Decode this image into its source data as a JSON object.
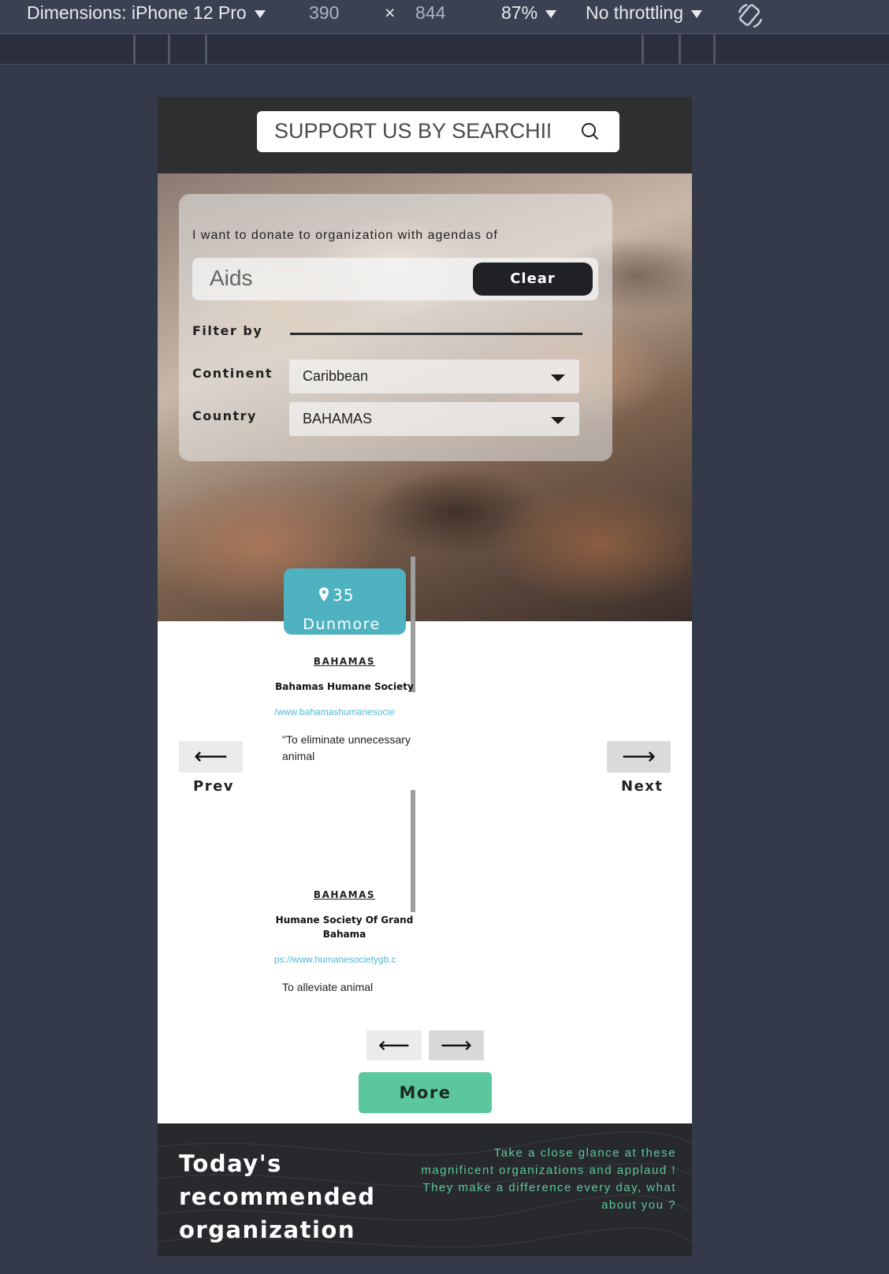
{
  "devtools": {
    "dimensions_label": "Dimensions: iPhone 12 Pro",
    "width": "390",
    "times": "×",
    "height": "844",
    "zoom": "87%",
    "throttling": "No throttling"
  },
  "search": {
    "placeholder": "SUPPORT US BY SEARCHIN"
  },
  "filter": {
    "title": "I want to donate to organization with agendas of",
    "agenda_value": "Aids",
    "clear_label": "Clear",
    "filter_by_label": "Filter by",
    "continent_label": "Continent",
    "continent_value": "Caribbean",
    "country_label": "Country",
    "country_value": "BAHAMAS"
  },
  "carousel": {
    "prev_label": "Prev",
    "next_label": "Next",
    "prev_arrow": "⟵",
    "next_arrow": "⟶"
  },
  "location_badge": {
    "count": "35",
    "city": "Dunmore"
  },
  "cards": [
    {
      "country": "BAHAMAS",
      "name": "Bahamas Humane Society",
      "url": "/www.bahamashumanesocie",
      "mission": "\"To eliminate unnecessary animal"
    },
    {
      "country": "BAHAMAS",
      "name": "Humane Society Of Grand Bahama",
      "url": "ps://www.humanesocietygb.c",
      "mission": "To alleviate animal"
    }
  ],
  "pager": {
    "prev_arrow": "⟵",
    "next_arrow": "⟶"
  },
  "more_label": "More",
  "footer": {
    "title": "Today's recommended organization",
    "text": "Take a close glance at these magnificent organizations and applaud ! They make a difference every day, what about you ?"
  },
  "colors": {
    "accent_green": "#5cc79d",
    "badge_teal": "#4fb2c0",
    "link_blue": "#55b7d3",
    "dark": "#27292c"
  }
}
